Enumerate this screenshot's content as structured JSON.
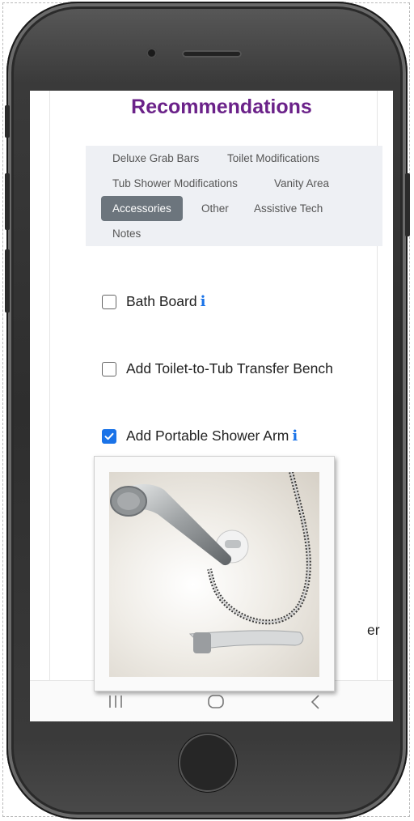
{
  "page_title": "Recommendations",
  "tabs": [
    {
      "label": "Deluxe Grab Bars",
      "active": false
    },
    {
      "label": "Toilet Modifications",
      "active": false
    },
    {
      "label": "Tub Shower Modifications",
      "active": false
    },
    {
      "label": "Vanity Area",
      "active": false
    },
    {
      "label": "Accessories",
      "active": true
    },
    {
      "label": "Other",
      "active": false
    },
    {
      "label": "Assistive Tech",
      "active": false
    },
    {
      "label": "Notes",
      "active": false
    }
  ],
  "items": [
    {
      "label": "Bath Board",
      "checked": false,
      "info_icon": true
    },
    {
      "label": "Add Toilet-to-Tub Transfer Bench",
      "checked": false,
      "info_icon": false
    },
    {
      "label": "Add Portable Shower Arm",
      "checked": true,
      "info_icon": true
    },
    {
      "label": "",
      "checked": false,
      "info_icon": false
    },
    {
      "label": "",
      "checked": false,
      "info_icon": false
    },
    {
      "label": "er",
      "checked": false,
      "info_icon": false
    }
  ],
  "info_glyph": "i",
  "popup_image": "handheld-shower-arm-photo",
  "colors": {
    "title": "#6b2289",
    "active_tab": "#6c757d",
    "tab_bg": "#eef0f4",
    "checkbox_checked": "#1a73e8",
    "info_icon": "#1a73e8"
  }
}
